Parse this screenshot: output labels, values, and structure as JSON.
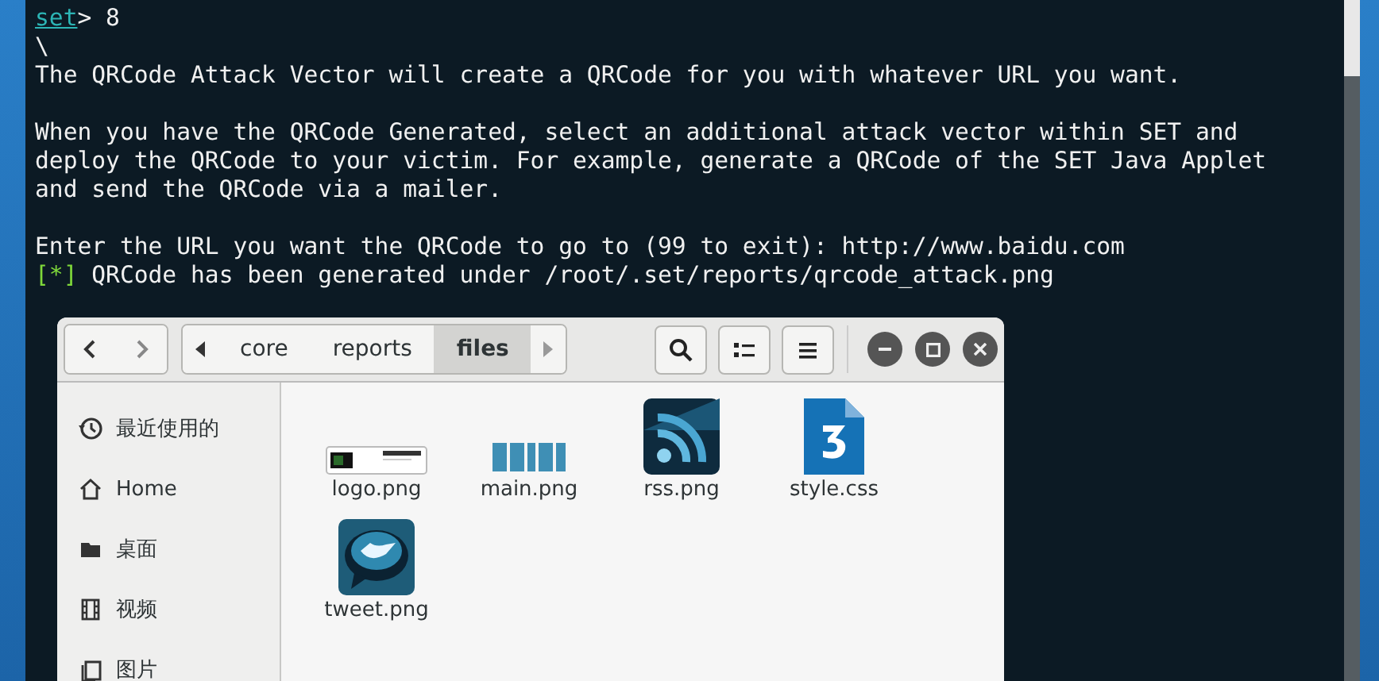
{
  "terminal": {
    "lines": [
      {
        "kind": "text",
        "segments": [
          {
            "kind": "prompt",
            "text": "set"
          },
          {
            "kind": "plain",
            "text": "> 8"
          }
        ]
      },
      {
        "kind": "text",
        "segments": [
          {
            "kind": "plain",
            "text": "\\"
          }
        ]
      },
      {
        "kind": "text",
        "segments": [
          {
            "kind": "plain",
            "text": "The QRCode Attack Vector will create a QRCode for you with whatever URL you want."
          }
        ]
      },
      {
        "kind": "blank"
      },
      {
        "kind": "text",
        "segments": [
          {
            "kind": "plain",
            "text": "When you have the QRCode Generated, select an additional attack vector within SET and"
          }
        ]
      },
      {
        "kind": "text",
        "segments": [
          {
            "kind": "plain",
            "text": "deploy the QRCode to your victim. For example, generate a QRCode of the SET Java Applet"
          }
        ]
      },
      {
        "kind": "text",
        "segments": [
          {
            "kind": "plain",
            "text": "and send the QRCode via a mailer."
          }
        ]
      },
      {
        "kind": "blank"
      },
      {
        "kind": "text",
        "segments": [
          {
            "kind": "plain",
            "text": "Enter the URL you want the QRCode to go to (99 to exit): http://www.baidu.com"
          }
        ]
      },
      {
        "kind": "text",
        "segments": [
          {
            "kind": "status",
            "text": "[*]"
          },
          {
            "kind": "plain",
            "text": " QRCode has been generated under /root/.set/reports/qrcode_attack.png"
          }
        ]
      }
    ]
  },
  "file_manager": {
    "path": [
      {
        "label": "core",
        "selected": false
      },
      {
        "label": "reports",
        "selected": false
      },
      {
        "label": "files",
        "selected": true
      }
    ],
    "sidebar": [
      {
        "label": "最近使用的",
        "kind": "recent"
      },
      {
        "label": "Home",
        "kind": "home"
      },
      {
        "label": "桌面",
        "kind": "folder"
      },
      {
        "label": "视频",
        "kind": "film"
      },
      {
        "label": "图片",
        "kind": "picture"
      }
    ],
    "files": [
      {
        "name": "logo.png",
        "kind": "logo"
      },
      {
        "name": "main.png",
        "kind": "main"
      },
      {
        "name": "rss.png",
        "kind": "rss"
      },
      {
        "name": "style.css",
        "kind": "css"
      },
      {
        "name": "tweet.png",
        "kind": "tweet"
      }
    ]
  }
}
